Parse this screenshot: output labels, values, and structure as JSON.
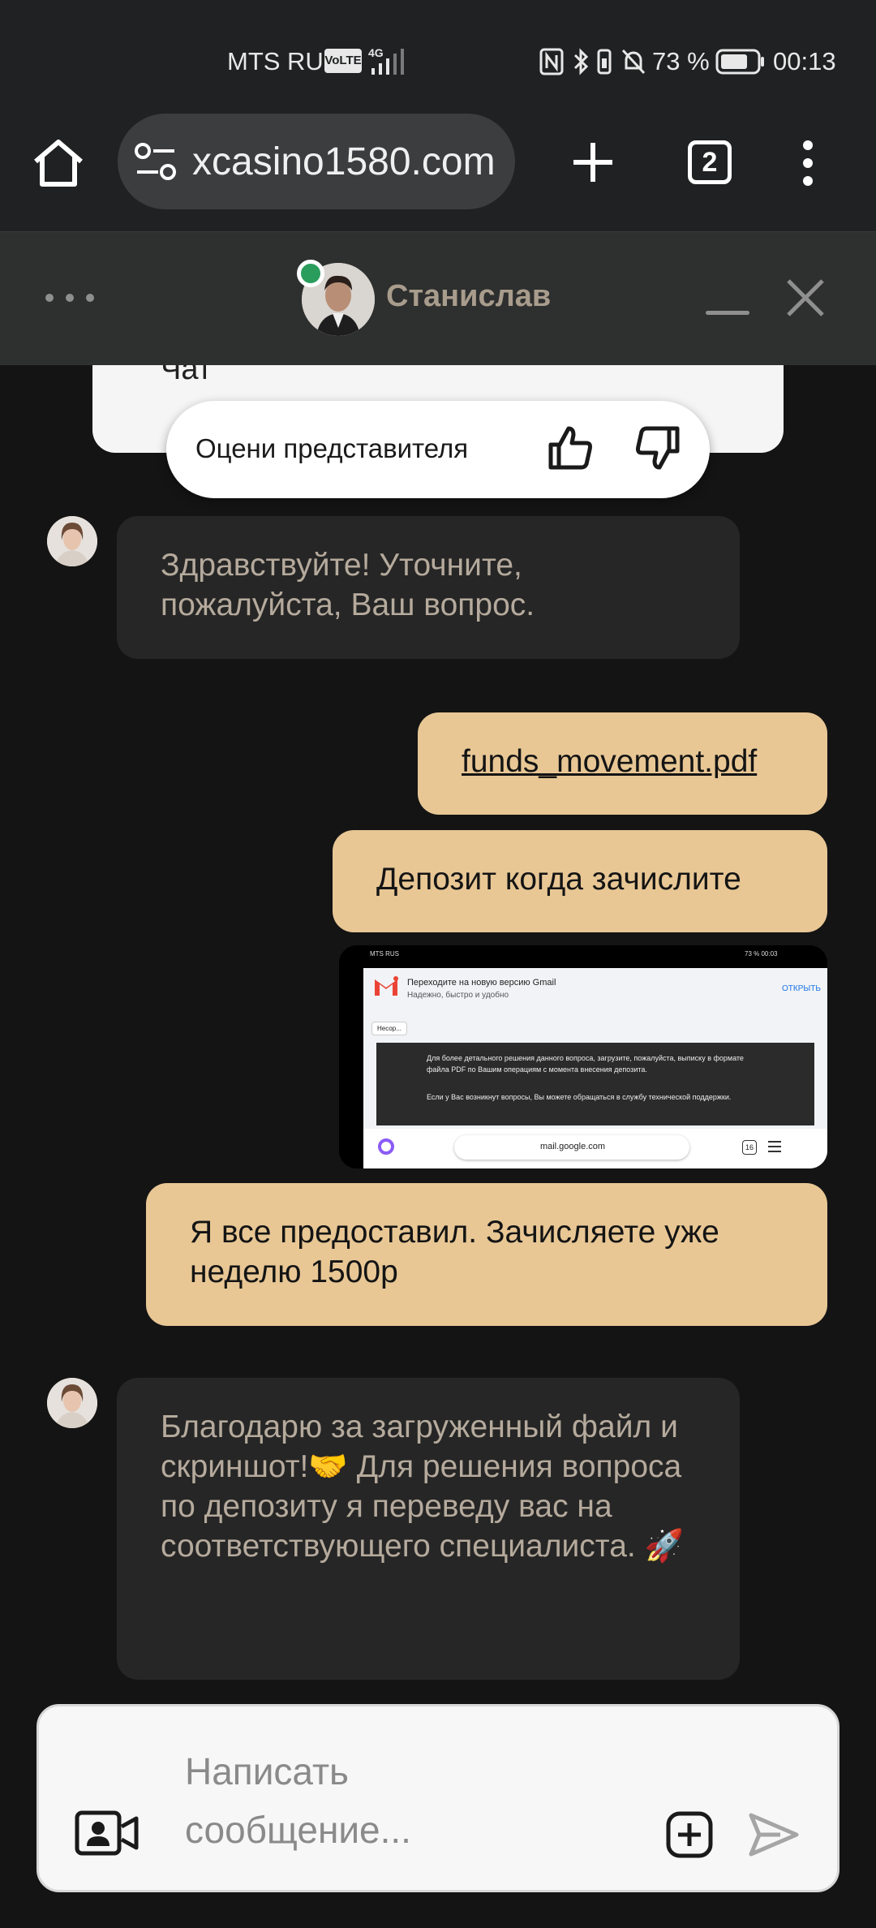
{
  "status_bar": {
    "carrier": "MTS RUS",
    "volte": "VoLTE",
    "network": "4G",
    "battery_percent": "73 %",
    "time": "00:13"
  },
  "browser": {
    "url": "xcasino1580.com",
    "tab_count": "2"
  },
  "chat_header": {
    "agent_name": "Станислав",
    "online_color": "#2a9d5c"
  },
  "previous_card": {
    "text": "Чат"
  },
  "rating": {
    "label": "Оцени представителя"
  },
  "messages": [
    {
      "from": "agent",
      "text": "Здравствуйте! Уточните, пожалуйста, Ваш вопрос."
    },
    {
      "from": "user",
      "type": "file",
      "text": "funds_movement.pdf"
    },
    {
      "from": "user",
      "text": "Депозит когда зачислите"
    },
    {
      "from": "user",
      "type": "image"
    },
    {
      "from": "user",
      "text": "Я все предоставил. Зачисляете уже неделю 1500р"
    },
    {
      "from": "agent",
      "text": "Благодарю за загруженный файл и скриншот!🤝 Для решения вопроса по депозиту я переведу вас на соответствующего специалиста. 🚀"
    }
  ],
  "screenshot": {
    "status_text": "MTS RUS",
    "status_right": "73 % 00:03",
    "gmail_title": "Переходите на новую версию Gmail",
    "gmail_subtitle": "Надежно, быстро и удобно",
    "gmail_action": "ОТКРЫТЬ",
    "tag": "Несор...",
    "body_line1": "Для более детального решения данного вопроса, загрузите, пожалуйста, выписку в формате файла PDF по Вашим операциям с момента внесения депозита.",
    "body_line2": "Если у Вас возникнут вопросы, Вы можете обращаться в службу технической поддержки.",
    "url": "mail.google.com",
    "tab_count": "16"
  },
  "input": {
    "placeholder": "Написать сообщение..."
  },
  "colors": {
    "user_bubble": "#e8c795",
    "agent_bubble": "#262626",
    "agent_text": "#b5aa9c",
    "background": "#141414",
    "header": "#2e2f2f"
  }
}
